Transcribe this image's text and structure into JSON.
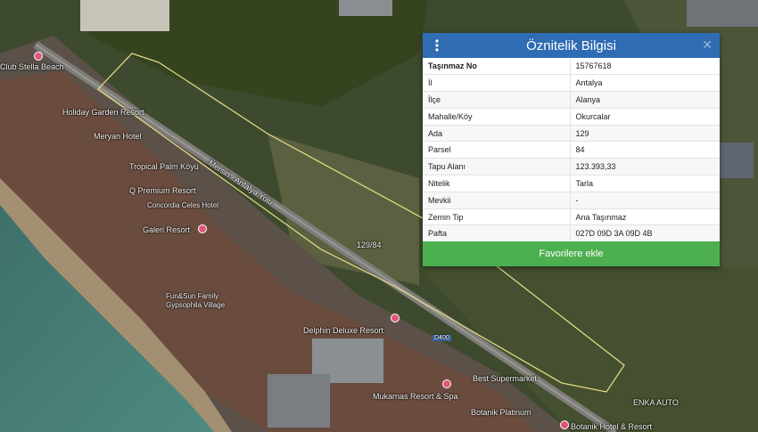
{
  "map": {
    "parcel_label": "129/84",
    "road_label": "Mersin - Antalya Yolu",
    "road_badge": "D400",
    "places": [
      "Club Stella Beach",
      "Holiday Garden Resort",
      "Meryan Hotel",
      "Tropical Palm Köyü",
      "Q Premium Resort",
      "Concordia Celes Hotel",
      "Galeri Resort",
      "Fun&Sun Family Gypsophila Village",
      "Delphin Deluxe Resort",
      "Best Supermarket",
      "Mukarnas Resort & Spa",
      "Botanik Platinum",
      "Botanik Hotel & Resort",
      "ENKA AUTO"
    ]
  },
  "panel": {
    "title": "Öznitelik Bilgisi",
    "menu_icon": "vertical-dots-icon",
    "close_icon": "close-icon",
    "rows": [
      {
        "key": "Taşınmaz No",
        "value": "15767618"
      },
      {
        "key": "İl",
        "value": "Antalya"
      },
      {
        "key": "İlçe",
        "value": "Alanya"
      },
      {
        "key": "Mahalle/Köy",
        "value": "Okurcalar"
      },
      {
        "key": "Ada",
        "value": "129"
      },
      {
        "key": "Parsel",
        "value": "84"
      },
      {
        "key": "Tapu Alanı",
        "value": "123.393,33"
      },
      {
        "key": "Nitelik",
        "value": "Tarla"
      },
      {
        "key": "Mevkii",
        "value": "-"
      },
      {
        "key": "Zemin Tip",
        "value": "Ana Taşınmaz"
      },
      {
        "key": "Pafta",
        "value": "027D 09D 3A 09D 4B"
      }
    ],
    "favorite_button": "Favorilere ekle"
  },
  "colors": {
    "header": "#2f6cb3",
    "button": "#4caf50",
    "parcel_outline": "#e8e08a"
  }
}
